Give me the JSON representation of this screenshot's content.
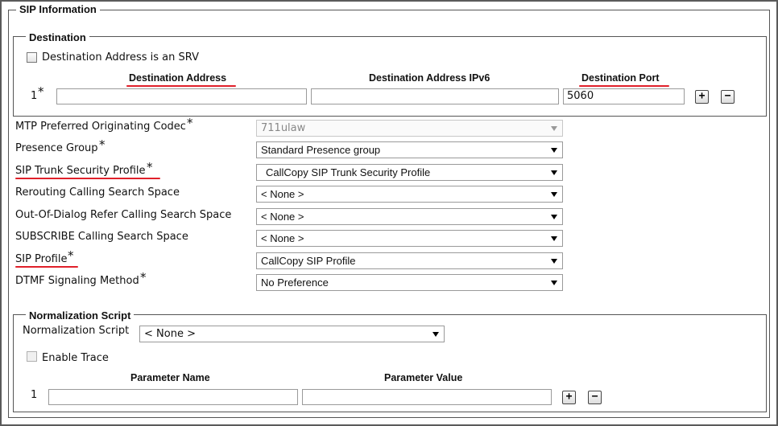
{
  "sip_information": {
    "legend": "SIP Information",
    "destination": {
      "legend": "Destination",
      "srv_checkbox_label": "Destination Address is an SRV",
      "srv_checked": false,
      "columns": {
        "address": "Destination Address",
        "address_ipv6": "Destination Address IPv6",
        "port": "Destination Port"
      },
      "rows": [
        {
          "index": "1",
          "required_mark": "*",
          "address": "",
          "address_ipv6": "",
          "port": "5060"
        }
      ],
      "add_button": "+",
      "remove_button": "−"
    },
    "fields": [
      {
        "label": "MTP Preferred Originating Codec",
        "required": "*",
        "value": "711ulaw",
        "disabled": true,
        "highlighted": false
      },
      {
        "label": "Presence Group",
        "required": "*",
        "value": "Standard Presence group",
        "disabled": false,
        "highlighted": false
      },
      {
        "label": "SIP Trunk Security Profile",
        "required": "*",
        "value": "CallCopy SIP Trunk Security Profile",
        "disabled": false,
        "highlighted": true
      },
      {
        "label": "Rerouting Calling Search Space",
        "required": "",
        "value": "< None >",
        "disabled": false,
        "highlighted": false
      },
      {
        "label": "Out-Of-Dialog Refer Calling Search Space",
        "required": "",
        "value": "< None >",
        "disabled": false,
        "highlighted": false
      },
      {
        "label": "SUBSCRIBE Calling Search Space",
        "required": "",
        "value": "< None >",
        "disabled": false,
        "highlighted": false
      },
      {
        "label": "SIP Profile",
        "required": "*",
        "value": "CallCopy SIP Profile",
        "disabled": false,
        "highlighted": true
      },
      {
        "label": "DTMF Signaling Method",
        "required": "*",
        "value": "No Preference",
        "disabled": false,
        "highlighted": false
      }
    ],
    "normalization": {
      "legend": "Normalization Script",
      "script_label": "Normalization Script",
      "script_value": "< None >",
      "enable_trace_label": "Enable Trace",
      "enable_trace_checked": false,
      "columns": {
        "name": "Parameter Name",
        "value": "Parameter Value"
      },
      "rows": [
        {
          "index": "1",
          "name": "",
          "value": ""
        }
      ],
      "add_button": "+",
      "remove_button": "−"
    }
  },
  "colors": {
    "annotation_underline": "#e0202a",
    "border": "#555555"
  },
  "icons": {
    "dropdown": "triangle-down-icon",
    "add": "plus-icon",
    "remove": "minus-icon"
  }
}
